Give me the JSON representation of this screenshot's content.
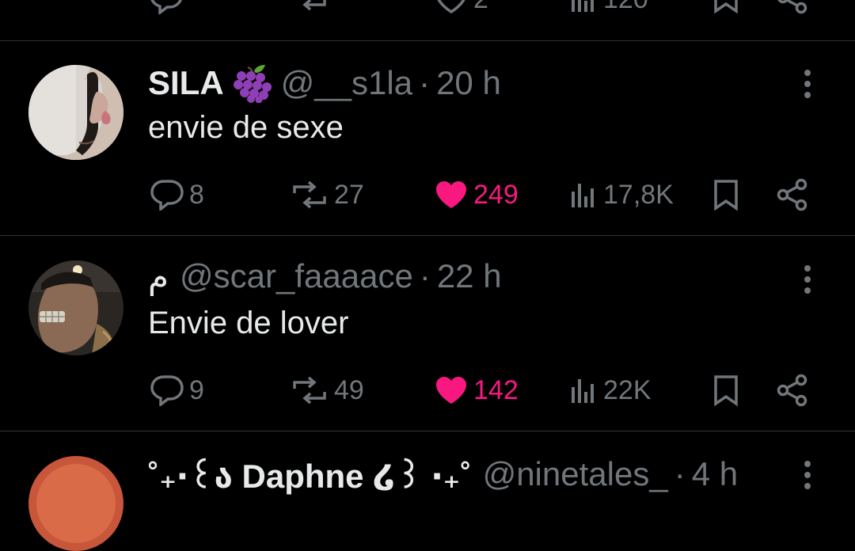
{
  "top_partial": {
    "like_count": "2",
    "views_count": "120"
  },
  "tweets": [
    {
      "display_name": "SILA",
      "emoji": "grapes-emoji",
      "handle": "@__s1la",
      "separator": "·",
      "time": "20 h",
      "text": "envie de sexe",
      "replies": "8",
      "retweets": "27",
      "likes": "249",
      "liked": true,
      "views": "17,8K"
    },
    {
      "display_name": "م",
      "handle": "@scar_faaaace",
      "separator": "·",
      "time": "22 h",
      "text": "Envie de lover",
      "replies": "9",
      "retweets": "49",
      "likes": "142",
      "liked": true,
      "views": "22K"
    },
    {
      "display_name": "˚₊‧꒰ა Daphne ໒꒱ ‧₊˚",
      "handle": "@ninetales_",
      "separator": "·",
      "time": "4 h"
    }
  ],
  "colors": {
    "background": "#000000",
    "text": "#e7e9ea",
    "muted": "#71767b",
    "like": "#f91880",
    "divider": "#2f3336"
  },
  "icons": [
    "reply-icon",
    "retweet-icon",
    "heart-icon",
    "views-icon",
    "bookmark-icon",
    "share-icon",
    "more-icon"
  ]
}
